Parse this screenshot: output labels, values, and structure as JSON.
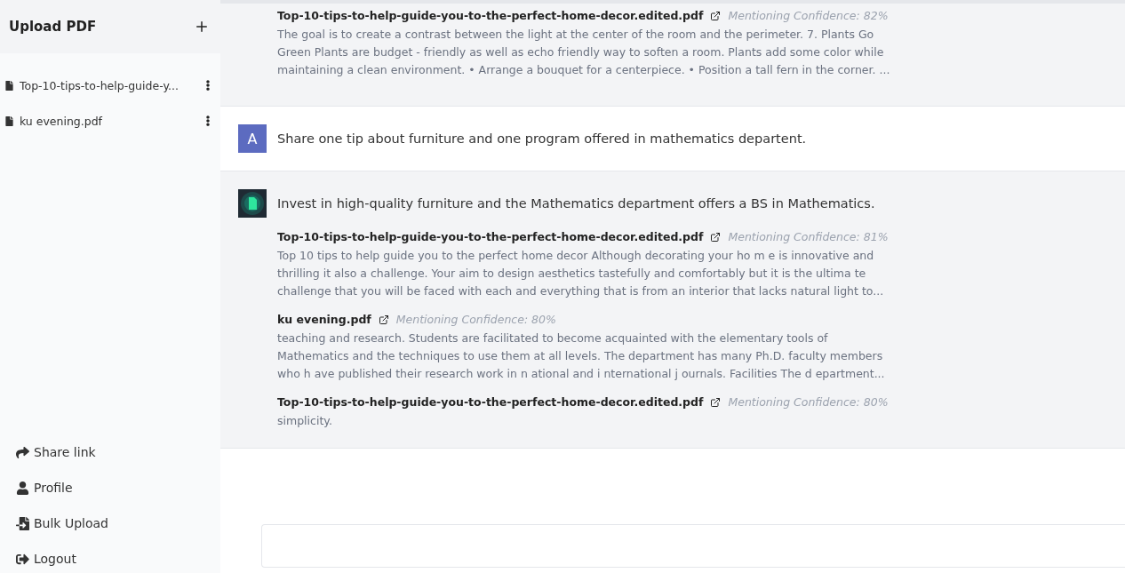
{
  "sidebar": {
    "title": "Upload PDF",
    "files": [
      {
        "name": "Top-10-tips-to-help-guide-y..."
      },
      {
        "name": "ku evening.pdf"
      }
    ],
    "links": [
      {
        "kind": "share",
        "label": "Share link"
      },
      {
        "kind": "profile",
        "label": "Profile"
      },
      {
        "kind": "bulk",
        "label": "Bulk Upload"
      },
      {
        "kind": "logout",
        "label": "Logout"
      }
    ]
  },
  "messages": [
    {
      "kind": "bot",
      "sources": [
        {
          "file": "Top-10-tips-to-help-guide-you-to-the-perfect-home-decor.edited.pdf",
          "confidence": "Mentioning Confidence: 82%",
          "snippet": "The goal is to create a contrast between the light at the center of the room and the perimeter. 7. Plants Go Green Plants are budget - friendly as well as echo friendly way to soften a room. Plants add some color while maintaining a clean environment. • Arrange a bouquet for a centerpiece. • Position a tall fern in the corner. ..."
        }
      ]
    },
    {
      "kind": "user",
      "avatar": "A",
      "text": "Share one tip about furniture and one program offered in mathematics departent."
    },
    {
      "kind": "bot",
      "text": "Invest in high-quality furniture and the Mathematics department offers a BS in Mathematics.",
      "sources": [
        {
          "file": "Top-10-tips-to-help-guide-you-to-the-perfect-home-decor.edited.pdf",
          "confidence": "Mentioning Confidence: 81%",
          "snippet": "Top 10 tips to help guide you to the perfect home decor Although decorating your ho m e is innovative and thrilling it also a challenge. Your aim to design aesthetics tastefully and comfortably but it is the ultima te challenge that you will be faced with each and everything that is from an interior that lacks natural light to..."
        },
        {
          "file": "ku evening.pdf",
          "confidence": "Mentioning Confidence: 80%",
          "snippet": "teaching and research. Students are facilitated to become acquainted with the elementary tools of Mathematics and the techniques to use them at all levels. The department has many Ph.D. faculty members who h ave published their research work in n ational and i nternational j ournals. Facilities The d epartment..."
        },
        {
          "file": "Top-10-tips-to-help-guide-you-to-the-perfect-home-decor.edited.pdf",
          "confidence": "Mentioning Confidence: 80%",
          "snippet": "simplicity."
        }
      ]
    }
  ]
}
